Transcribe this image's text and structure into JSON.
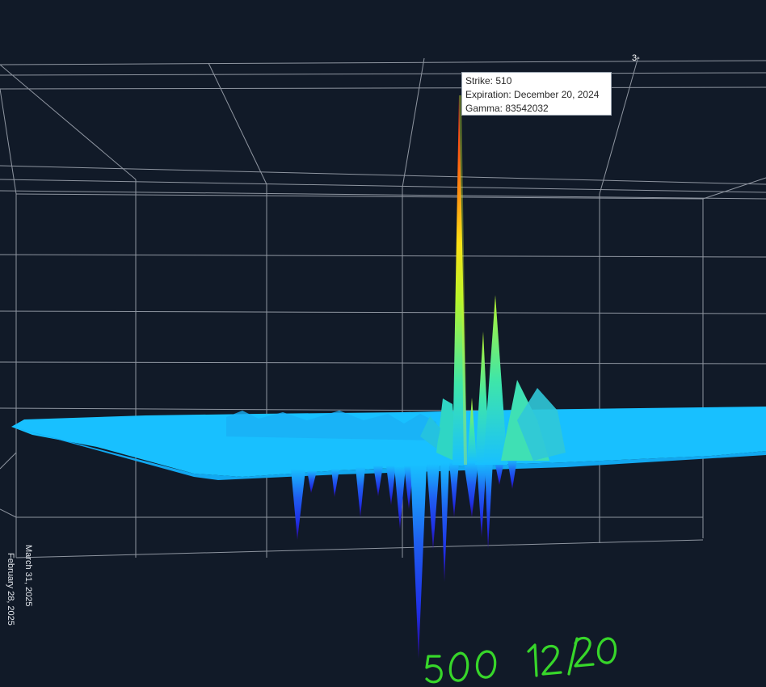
{
  "chart_data": {
    "type": "surface",
    "title": "",
    "tooltip": {
      "strike_label": "Strike: 510",
      "expiration_label": "Expiration: December 20, 2024",
      "gamma_label": "Gamma: 83542032",
      "strike": 510,
      "expiration": "December 20, 2024",
      "gamma": 83542032
    },
    "expiration_tick_labels": [
      "March 31, 2025",
      "February 28, 2025"
    ],
    "corner_label": "3-",
    "peak": {
      "strike": 510,
      "expiration": "December 20, 2024",
      "gamma": 83542032
    },
    "colorscale": [
      "#2a0a8f",
      "#1f2fe6",
      "#1c8fe8",
      "#18c0ff",
      "#3fe6a8",
      "#b8f52a",
      "#ffe014",
      "#ff6a10",
      "#e4141a"
    ],
    "grid": true
  },
  "annotation": {
    "handwritten_text": "500 12/20",
    "color": "#37d62a"
  },
  "colors": {
    "background": "#111a28",
    "gridline": "#b8bec8",
    "surface_base": "#18c0ff"
  }
}
